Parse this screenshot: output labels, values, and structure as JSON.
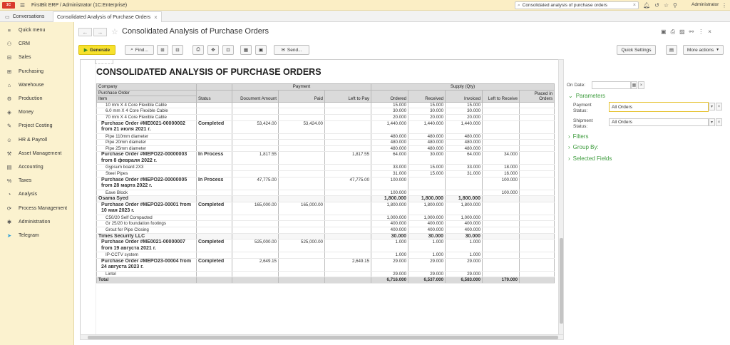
{
  "app": {
    "title": "FirstBit ERP / Administrator  (1C:Enterprise)",
    "user": "Administrator"
  },
  "search": {
    "value": "Consolidated analysis of purchase orders"
  },
  "tabs": [
    {
      "label": "Conversations"
    },
    {
      "label": "Consolidated Analysis of Purchase Orders"
    }
  ],
  "sidebar": {
    "items": [
      {
        "label": "Quick menu",
        "icon": "menu-icon"
      },
      {
        "label": "CRM",
        "icon": "crm-icon"
      },
      {
        "label": "Sales",
        "icon": "sales-icon"
      },
      {
        "label": "Purchasing",
        "icon": "purchasing-icon"
      },
      {
        "label": "Warehouse",
        "icon": "warehouse-icon"
      },
      {
        "label": "Production",
        "icon": "production-icon"
      },
      {
        "label": "Money",
        "icon": "money-icon"
      },
      {
        "label": "Project Costing",
        "icon": "project-icon"
      },
      {
        "label": "HR & Payroll",
        "icon": "hr-icon"
      },
      {
        "label": "Asset Management",
        "icon": "asset-icon"
      },
      {
        "label": "Accounting",
        "icon": "accounting-icon"
      },
      {
        "label": "Taxes",
        "icon": "taxes-icon"
      },
      {
        "label": "Analysis",
        "icon": "analysis-icon"
      },
      {
        "label": "Process Management",
        "icon": "process-icon"
      },
      {
        "label": "Administration",
        "icon": "admin-icon"
      },
      {
        "label": "Telegram",
        "icon": "telegram-icon"
      }
    ]
  },
  "page": {
    "title": "Consolidated Analysis of Purchase Orders"
  },
  "toolbar": {
    "generate": "Generate",
    "find": "Find...",
    "send": "Send...",
    "quick_settings": "Quick Settings",
    "more_actions": "More actions"
  },
  "report": {
    "title": "CONSOLIDATED ANALYSIS OF PURCHASE ORDERS",
    "headers": {
      "company": "Company",
      "purchase_order": "Purchase Order",
      "item": "Item",
      "status": "Status",
      "payment": "Payment",
      "supply": "Supply (Qty)",
      "doc_amount": "Document Amount",
      "paid": "Paid",
      "left_to_pay": "Left to Pay",
      "ordered": "Ordered",
      "received": "Received",
      "invoiced": "Invoiced",
      "left_to_receive": "Left to Receive",
      "placed_in_orders": "Placed in Orders"
    },
    "rows": [
      {
        "type": "item",
        "name": "10 mm X 4 Core Flexible Cable",
        "status": "",
        "doc": "",
        "paid": "",
        "ltp": "",
        "ord": "15.000",
        "rec": "15.000",
        "inv": "15.000",
        "ltr": "",
        "pio": ""
      },
      {
        "type": "item",
        "name": "6.0 mm X 4 Core Flexible Cable",
        "status": "",
        "doc": "",
        "paid": "",
        "ltp": "",
        "ord": "30.000",
        "rec": "30.000",
        "inv": "30.000",
        "ltr": "",
        "pio": ""
      },
      {
        "type": "item",
        "name": "70 mm X 4 Core Flexible Cable",
        "status": "",
        "doc": "",
        "paid": "",
        "ltp": "",
        "ord": "20.000",
        "rec": "20.000",
        "inv": "20.000",
        "ltr": "",
        "pio": ""
      },
      {
        "type": "po",
        "name": "Purchase Order #ME0021-00000002 from 21 июля 2021 г.",
        "status": "Completed",
        "doc": "53,424.00",
        "paid": "53,424.00",
        "ltp": "",
        "ord": "1,440.000",
        "rec": "1,440.000",
        "inv": "1,440.000",
        "ltr": "",
        "pio": ""
      },
      {
        "type": "item",
        "name": "Pipe 110mm diameter",
        "status": "",
        "doc": "",
        "paid": "",
        "ltp": "",
        "ord": "480.000",
        "rec": "480.000",
        "inv": "480.000",
        "ltr": "",
        "pio": ""
      },
      {
        "type": "item",
        "name": "Pipe 20mm diameter",
        "status": "",
        "doc": "",
        "paid": "",
        "ltp": "",
        "ord": "480.000",
        "rec": "480.000",
        "inv": "480.000",
        "ltr": "",
        "pio": ""
      },
      {
        "type": "item",
        "name": "Pipe 25mm diameter",
        "status": "",
        "doc": "",
        "paid": "",
        "ltp": "",
        "ord": "480.000",
        "rec": "480.000",
        "inv": "480.000",
        "ltr": "",
        "pio": ""
      },
      {
        "type": "po",
        "name": "Purchase Order #MEPO22-00000003 from 8 февраля 2022 г.",
        "status": "In Process",
        "doc": "1,817.55",
        "paid": "",
        "ltp": "1,817.55",
        "ord": "64.000",
        "rec": "30.000",
        "inv": "64.000",
        "ltr": "34.000",
        "pio": ""
      },
      {
        "type": "item",
        "name": "Gypsum board 2X3",
        "status": "",
        "doc": "",
        "paid": "",
        "ltp": "",
        "ord": "33.000",
        "rec": "15.000",
        "inv": "33.000",
        "ltr": "18.000",
        "pio": ""
      },
      {
        "type": "item",
        "name": "Steel Pipes",
        "status": "",
        "doc": "",
        "paid": "",
        "ltp": "",
        "ord": "31.000",
        "rec": "15.000",
        "inv": "31.000",
        "ltr": "16.000",
        "pio": ""
      },
      {
        "type": "po",
        "name": "Purchase Order #MEPO22-00000005 from 28 марта 2022 г.",
        "status": "In Process",
        "doc": "47,775.00",
        "paid": "",
        "ltp": "47,775.00",
        "ord": "100.000",
        "rec": "",
        "inv": "",
        "ltr": "100.000",
        "pio": ""
      },
      {
        "type": "item",
        "name": "Eave Block",
        "status": "",
        "doc": "",
        "paid": "",
        "ltp": "",
        "ord": "100.000",
        "rec": "",
        "inv": "",
        "ltr": "100.000",
        "pio": ""
      },
      {
        "type": "company",
        "name": "Osama Syed",
        "status": "",
        "doc": "",
        "paid": "",
        "ltp": "",
        "ord": "1,800.000",
        "rec": "1,800.000",
        "inv": "1,800.000",
        "ltr": "",
        "pio": ""
      },
      {
        "type": "po",
        "name": "Purchase Order #MEPO23-00001 from 10 мая 2023 г.",
        "status": "Completed",
        "doc": "165,000.00",
        "paid": "165,000.00",
        "ltp": "",
        "ord": "1,800.000",
        "rec": "1,800.000",
        "inv": "1,800.000",
        "ltr": "",
        "pio": ""
      },
      {
        "type": "item",
        "name": "C50/20 Self Compacted",
        "status": "",
        "doc": "",
        "paid": "",
        "ltp": "",
        "ord": "1,000.000",
        "rec": "1,000.000",
        "inv": "1,000.000",
        "ltr": "",
        "pio": ""
      },
      {
        "type": "item",
        "name": "Gr 25/20 to foundation footings",
        "status": "",
        "doc": "",
        "paid": "",
        "ltp": "",
        "ord": "400.000",
        "rec": "400.000",
        "inv": "400.000",
        "ltr": "",
        "pio": ""
      },
      {
        "type": "item",
        "name": "Grout for Pipe Closing",
        "status": "",
        "doc": "",
        "paid": "",
        "ltp": "",
        "ord": "400.000",
        "rec": "400.000",
        "inv": "400.000",
        "ltr": "",
        "pio": ""
      },
      {
        "type": "company",
        "name": "Times Security LLC",
        "status": "",
        "doc": "",
        "paid": "",
        "ltp": "",
        "ord": "30.000",
        "rec": "30.000",
        "inv": "30.000",
        "ltr": "",
        "pio": ""
      },
      {
        "type": "po",
        "name": "Purchase Order #ME0021-00000007 from 19 августа 2021 г.",
        "status": "Completed",
        "doc": "525,000.00",
        "paid": "525,000.00",
        "ltp": "",
        "ord": "1.000",
        "rec": "1.000",
        "inv": "1.000",
        "ltr": "",
        "pio": ""
      },
      {
        "type": "item",
        "name": "IP-CCTV system",
        "status": "",
        "doc": "",
        "paid": "",
        "ltp": "",
        "ord": "1.000",
        "rec": "1.000",
        "inv": "1.000",
        "ltr": "",
        "pio": ""
      },
      {
        "type": "po",
        "name": "Purchase Order #MEPO23-00004 from 24 августа 2023 г.",
        "status": "Completed",
        "doc": "2,649.15",
        "paid": "",
        "ltp": "2,649.15",
        "ord": "29.000",
        "rec": "29.000",
        "inv": "29.000",
        "ltr": "",
        "pio": ""
      },
      {
        "type": "item",
        "name": "Lintel",
        "status": "",
        "doc": "",
        "paid": "",
        "ltp": "",
        "ord": "29.000",
        "rec": "29.000",
        "inv": "29.000",
        "ltr": "",
        "pio": ""
      },
      {
        "type": "total",
        "name": "Total",
        "status": "",
        "doc": "",
        "paid": "",
        "ltp": "",
        "ord": "6,716.000",
        "rec": "6,537.000",
        "inv": "6,583.000",
        "ltr": "179.000",
        "pio": ""
      }
    ]
  },
  "right_panel": {
    "on_date_label": "On Date:",
    "on_date_value": "",
    "parameters": "Parameters",
    "payment_status_label": "Payment Status:",
    "payment_status_value": "All Orders",
    "shipment_status_label": "Shipment Status:",
    "shipment_status_value": "All Orders",
    "filters": "Filters",
    "group_by": "Group By:",
    "selected_fields": "Selected Fields"
  },
  "colors": {
    "accent": "#f7e12c",
    "sidebar_bg": "#fbf2cf",
    "section_green": "#3e9c3e"
  }
}
